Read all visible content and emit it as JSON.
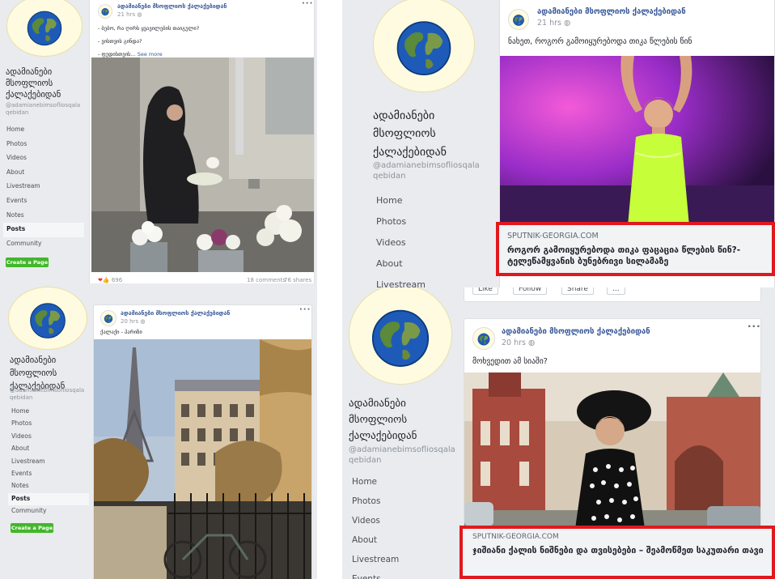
{
  "page": {
    "name_lines": [
      "ადამიანები",
      "მსოფლიოს",
      "ქალაქებიდან"
    ],
    "handle_lines": [
      "@adamianebimsofliosqala",
      "qebidan"
    ],
    "logo_text": "ადამიანები მსოფლიოს ქალაქებიდან"
  },
  "nav": [
    "Home",
    "Photos",
    "Videos",
    "About",
    "Livestream",
    "Events",
    "Notes",
    "Posts",
    "Community"
  ],
  "create_page_label": "Create a Page",
  "post1": {
    "author": "ადამიანები მსოფლიოს ქალაქებიდან",
    "time": "21 hrs",
    "lines": [
      "- ბებო, რა ღირს ყვავილების თაიგული?",
      "- ვისთვის გინდა?",
      "- ფედისთვის..."
    ],
    "see_more": "See more",
    "reactions": "696",
    "comments": "18 comments",
    "shares": "76 shares"
  },
  "post2": {
    "author": "ადამიანები მსოფლიოს ქალაქებიდან",
    "time": "21 hrs",
    "text": "ნახეთ, როგორ გამოიყურებოდა თიკა წლების წინ",
    "link_source": "SPUTNIK-GEORGIA.COM",
    "link_title": "როგორ გამოიყურებოდა თიკა ფაცაცია წლების წინ?- ტელეწამყვანის ბუნებრივი სილამაზე"
  },
  "post3": {
    "author": "ადამიანები მსოფლიოს ქალაქებიდან",
    "time": "20 hrs",
    "text": "ქალაქი - პარიზი"
  },
  "post4": {
    "author": "ადამიანები მსოფლიოს ქალაქებიდან",
    "time": "20 hrs",
    "text": "მოხვედით ამ სიაში?",
    "actions": [
      "Like",
      "Follow",
      "Share",
      "..."
    ],
    "link_source": "SPUTNIK-GEORGIA.COM",
    "link_title": "ჯიშიანი ქალის ნიშნები და თვისებები – შეამოწმეთ საკუთარი თავი"
  },
  "colors": {
    "accent_red": "#e0191e",
    "link_blue": "#385898",
    "green": "#42b72a"
  }
}
